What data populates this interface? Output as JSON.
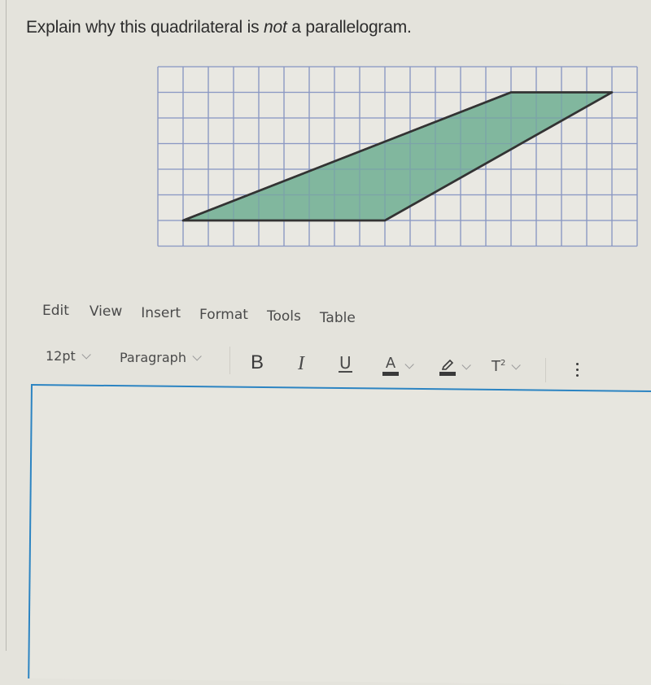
{
  "question": {
    "prefix": "Explain why this quadrilateral is ",
    "emphasis": "not",
    "suffix": " a parallelogram."
  },
  "figure": {
    "grid_columns": 19,
    "grid_rows": 7,
    "vertices_grid_units": [
      [
        14,
        1
      ],
      [
        18,
        1
      ],
      [
        9,
        6
      ],
      [
        1,
        6
      ]
    ],
    "fill_color": "#6fae92",
    "outline_color": "#333333",
    "grid_color": "#8a98c4"
  },
  "editor": {
    "menu": [
      "Edit",
      "View",
      "Insert",
      "Format",
      "Tools",
      "Table"
    ],
    "toolbar": {
      "font_size": "12pt",
      "block_format": "Paragraph",
      "bold": "B",
      "italic": "I",
      "underline": "U",
      "text_color": "A",
      "superscript": "T",
      "superscript_mark": "2"
    },
    "content": "",
    "accent_color": "#2c84c2"
  }
}
